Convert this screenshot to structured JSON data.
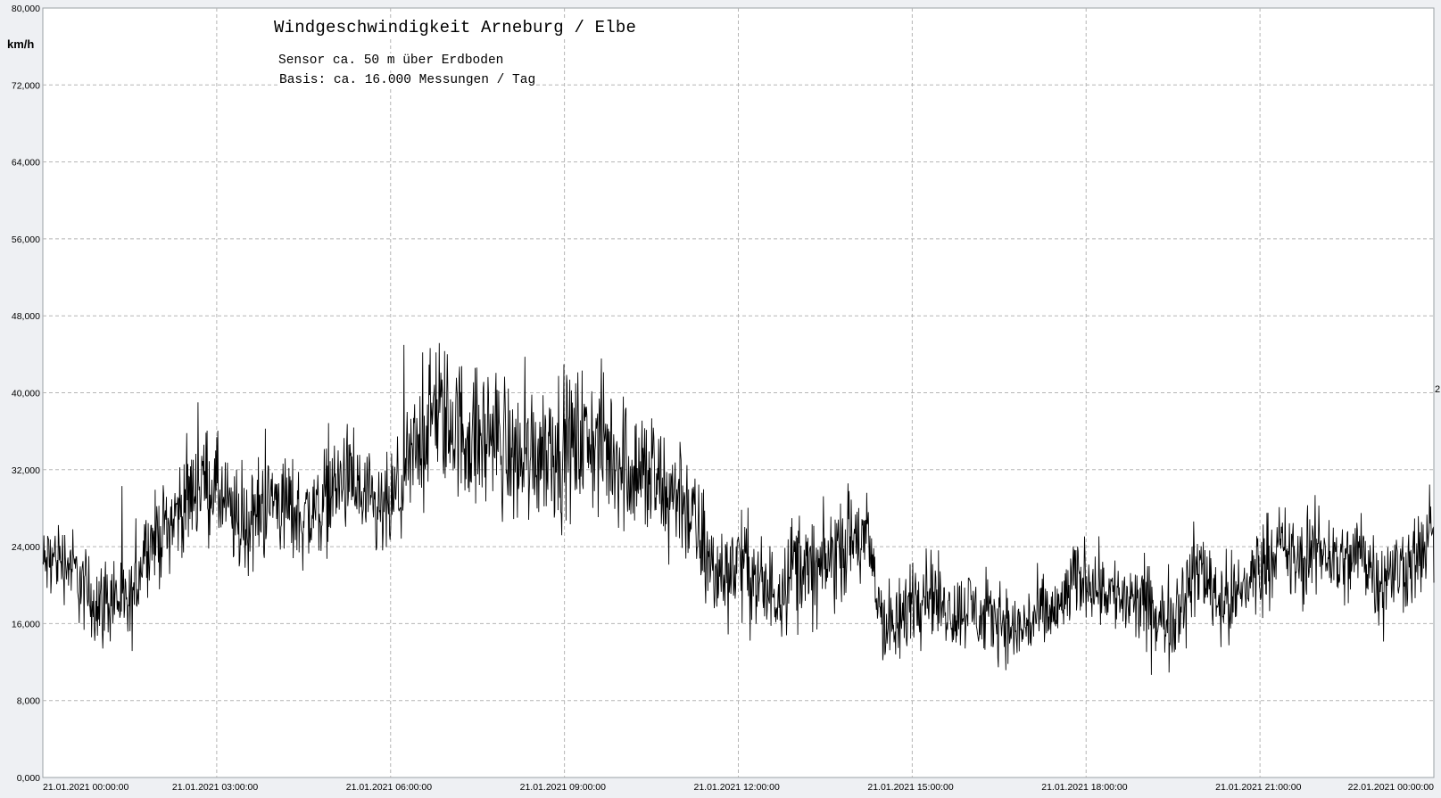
{
  "chart_data": {
    "type": "line",
    "title": "Windgeschwindigkeit  Arneburg / Elbe",
    "subtitle_lines": [
      "Sensor ca. 50 m über Erdboden",
      "Basis: ca. 16.000 Messungen / Tag"
    ],
    "xlabel": "",
    "ylabel": "km/h",
    "ylim": [
      0,
      80
    ],
    "yticks": [
      0,
      8,
      16,
      24,
      32,
      40,
      48,
      56,
      64,
      72,
      80
    ],
    "ytick_labels": [
      "0,000",
      "8,000",
      "16,000",
      "24,000",
      "32,000",
      "40,000",
      "48,000",
      "56,000",
      "64,000",
      "72,000",
      "80,000"
    ],
    "xlim_hours": [
      0,
      24
    ],
    "xticks_hours": [
      0,
      3,
      6,
      9,
      12,
      15,
      18,
      21,
      24
    ],
    "xtick_labels": [
      "21.01.2021  00:00:00",
      "21.01.2021  03:00:00",
      "21.01.2021  06:00:00",
      "21.01.2021  09:00:00",
      "21.01.2021  12:00:00",
      "21.01.2021  15:00:00",
      "21.01.2021  18:00:00",
      "21.01.2021  21:00:00",
      "22.01.2021  00:00:00"
    ],
    "grid": true,
    "edge_label": "2",
    "series": [
      {
        "color": "#000000",
        "x": [
          0,
          0.25,
          0.5,
          0.75,
          1,
          1.25,
          1.5,
          1.75,
          2,
          2.25,
          2.5,
          2.75,
          3,
          3.25,
          3.5,
          3.75,
          4,
          4.25,
          4.5,
          4.75,
          5,
          5.25,
          5.5,
          5.75,
          6,
          6.25,
          6.5,
          6.75,
          7,
          7.25,
          7.5,
          7.75,
          8,
          8.25,
          8.5,
          8.75,
          9,
          9.25,
          9.5,
          9.75,
          10,
          10.25,
          10.5,
          10.75,
          11,
          11.25,
          11.5,
          11.75,
          12,
          12.25,
          12.5,
          12.75,
          13,
          13.25,
          13.5,
          13.75,
          14,
          14.25,
          14.5,
          14.75,
          15,
          15.25,
          15.5,
          15.75,
          16,
          16.25,
          16.5,
          16.75,
          17,
          17.25,
          17.5,
          17.75,
          18,
          18.25,
          18.5,
          18.75,
          19,
          19.25,
          19.5,
          19.75,
          20,
          20.25,
          20.5,
          20.75,
          21,
          21.25,
          21.5,
          21.75,
          22,
          22.25,
          22.5,
          22.75,
          23,
          23.25,
          23.5,
          23.75,
          24
        ],
        "mean": [
          22,
          23,
          22,
          19,
          18,
          19,
          17,
          24,
          25,
          27,
          29,
          31,
          30,
          27,
          26,
          28,
          29,
          28,
          27,
          28,
          30,
          31,
          29,
          27,
          28,
          31,
          35,
          38,
          37,
          36,
          35,
          36,
          34,
          33,
          34,
          35,
          34,
          35,
          35,
          34,
          33,
          32,
          31,
          29,
          30,
          26,
          22,
          21,
          23,
          21,
          19,
          20,
          23,
          21,
          22,
          24,
          25,
          24,
          16,
          15,
          19,
          20,
          18,
          17,
          18,
          16,
          17,
          15,
          16,
          17,
          17,
          20,
          21,
          20,
          19,
          18,
          18,
          16,
          17,
          20,
          22,
          19,
          18,
          20,
          22,
          24,
          23,
          22,
          24,
          23,
          22,
          24,
          21,
          21,
          22,
          23,
          25
        ],
        "spread": [
          6,
          6,
          6,
          7,
          7,
          7,
          7,
          6,
          7,
          7,
          8,
          8,
          8,
          8,
          8,
          8,
          8,
          8,
          8,
          8,
          8,
          8,
          8,
          8,
          8,
          9,
          10,
          11,
          11,
          11,
          11,
          11,
          11,
          11,
          11,
          11,
          11,
          11,
          11,
          11,
          11,
          11,
          11,
          10,
          10,
          9,
          8,
          8,
          8,
          8,
          8,
          8,
          8,
          8,
          8,
          8,
          8,
          8,
          7,
          7,
          7,
          7,
          6,
          6,
          6,
          6,
          6,
          6,
          6,
          6,
          6,
          6,
          6,
          6,
          6,
          6,
          7,
          7,
          7,
          7,
          7,
          7,
          7,
          7,
          7,
          7,
          7,
          7,
          7,
          7,
          7,
          7,
          7,
          7,
          7,
          7,
          7
        ]
      }
    ]
  }
}
